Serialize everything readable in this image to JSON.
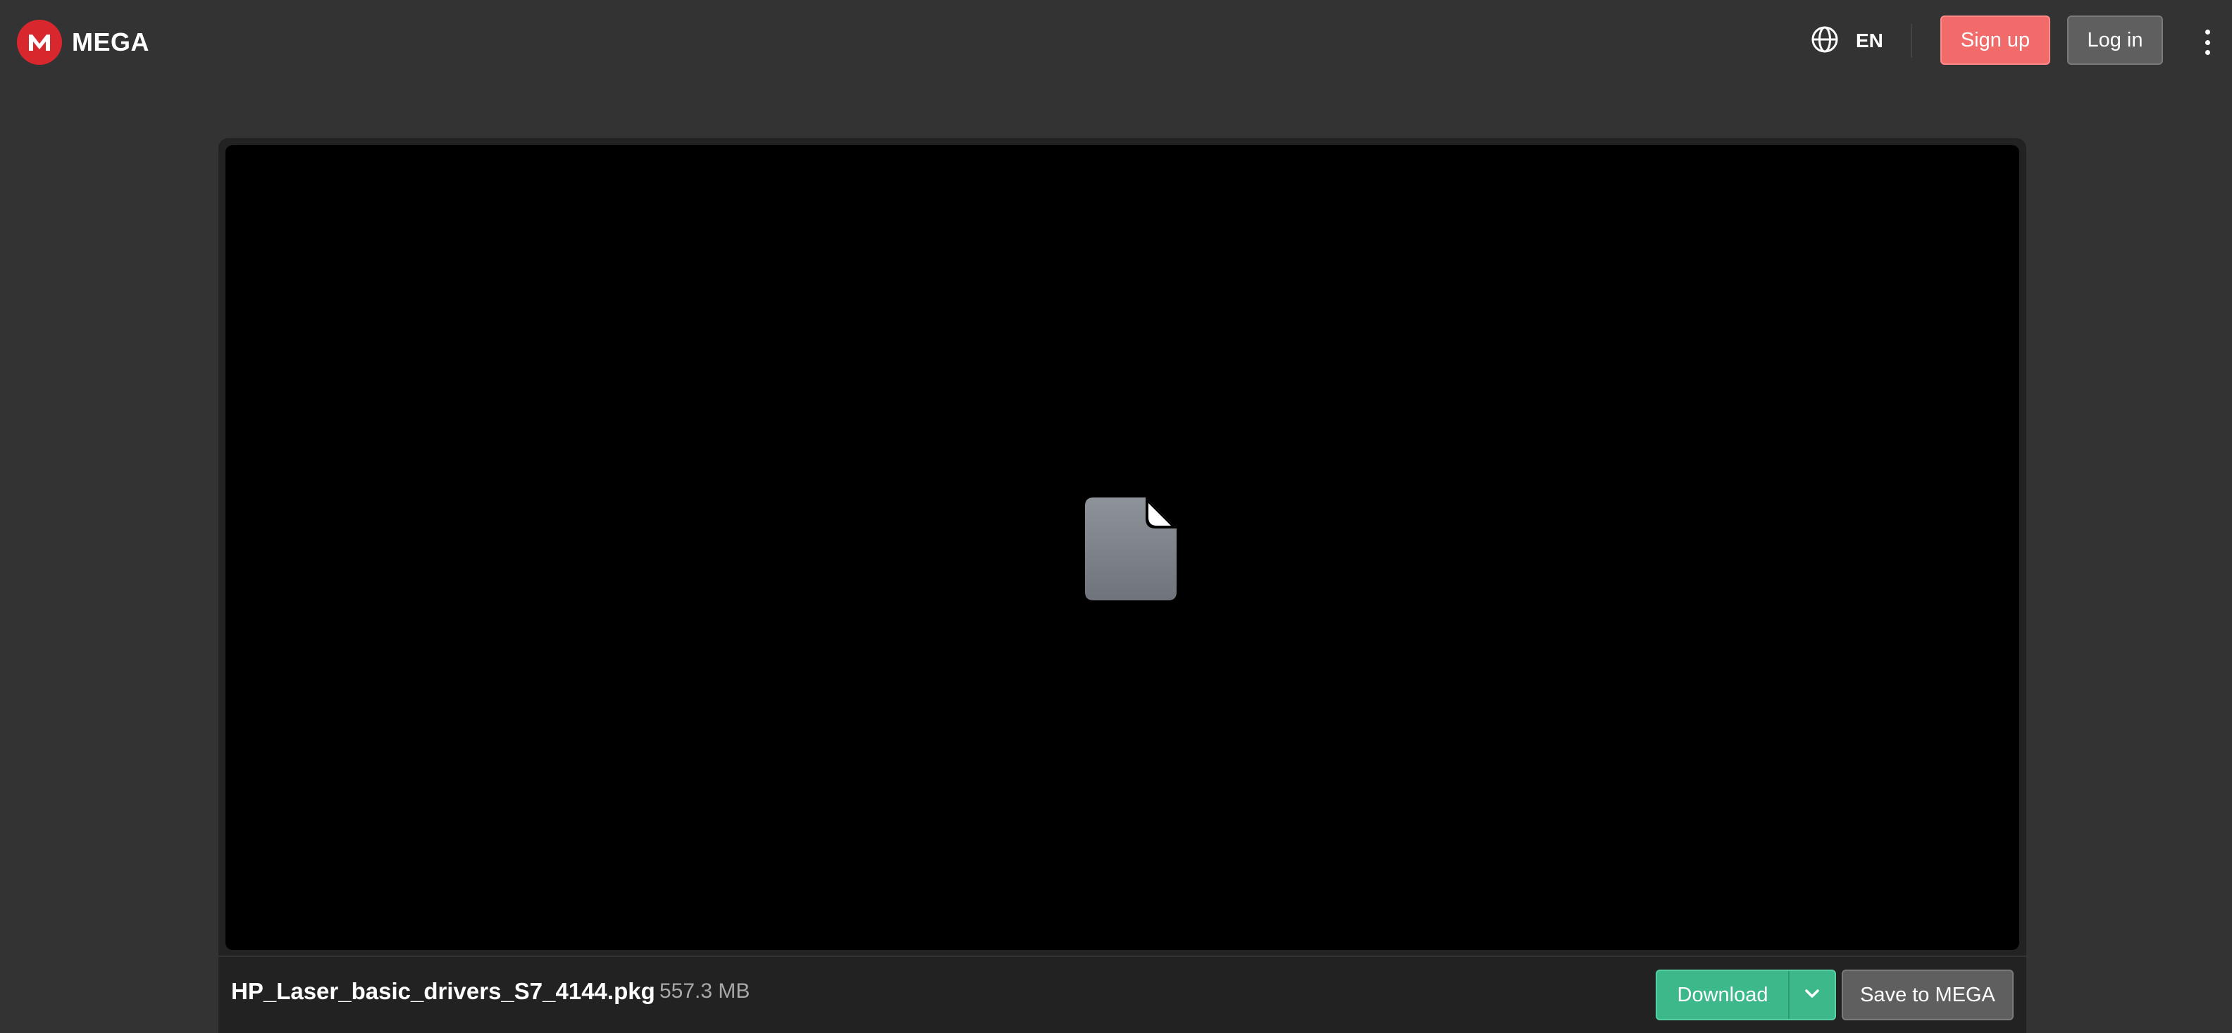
{
  "header": {
    "logo_text": "MEGA",
    "language": "EN",
    "signup_label": "Sign up",
    "login_label": "Log in"
  },
  "file": {
    "name": "HP_Laser_basic_drivers_S7_4144.pkg",
    "size": "557.3 MB"
  },
  "actions": {
    "download_label": "Download",
    "save_label": "Save to MEGA"
  },
  "icons": {
    "logo": "mega-logo-icon",
    "language": "globe-icon",
    "menu": "more-vertical-icon",
    "preview": "generic-file-icon",
    "dropdown": "chevron-down-icon"
  },
  "colors": {
    "brand_red": "#d9272e",
    "signup": "#f26b6b",
    "download": "#3cb88a",
    "background": "#333333"
  }
}
